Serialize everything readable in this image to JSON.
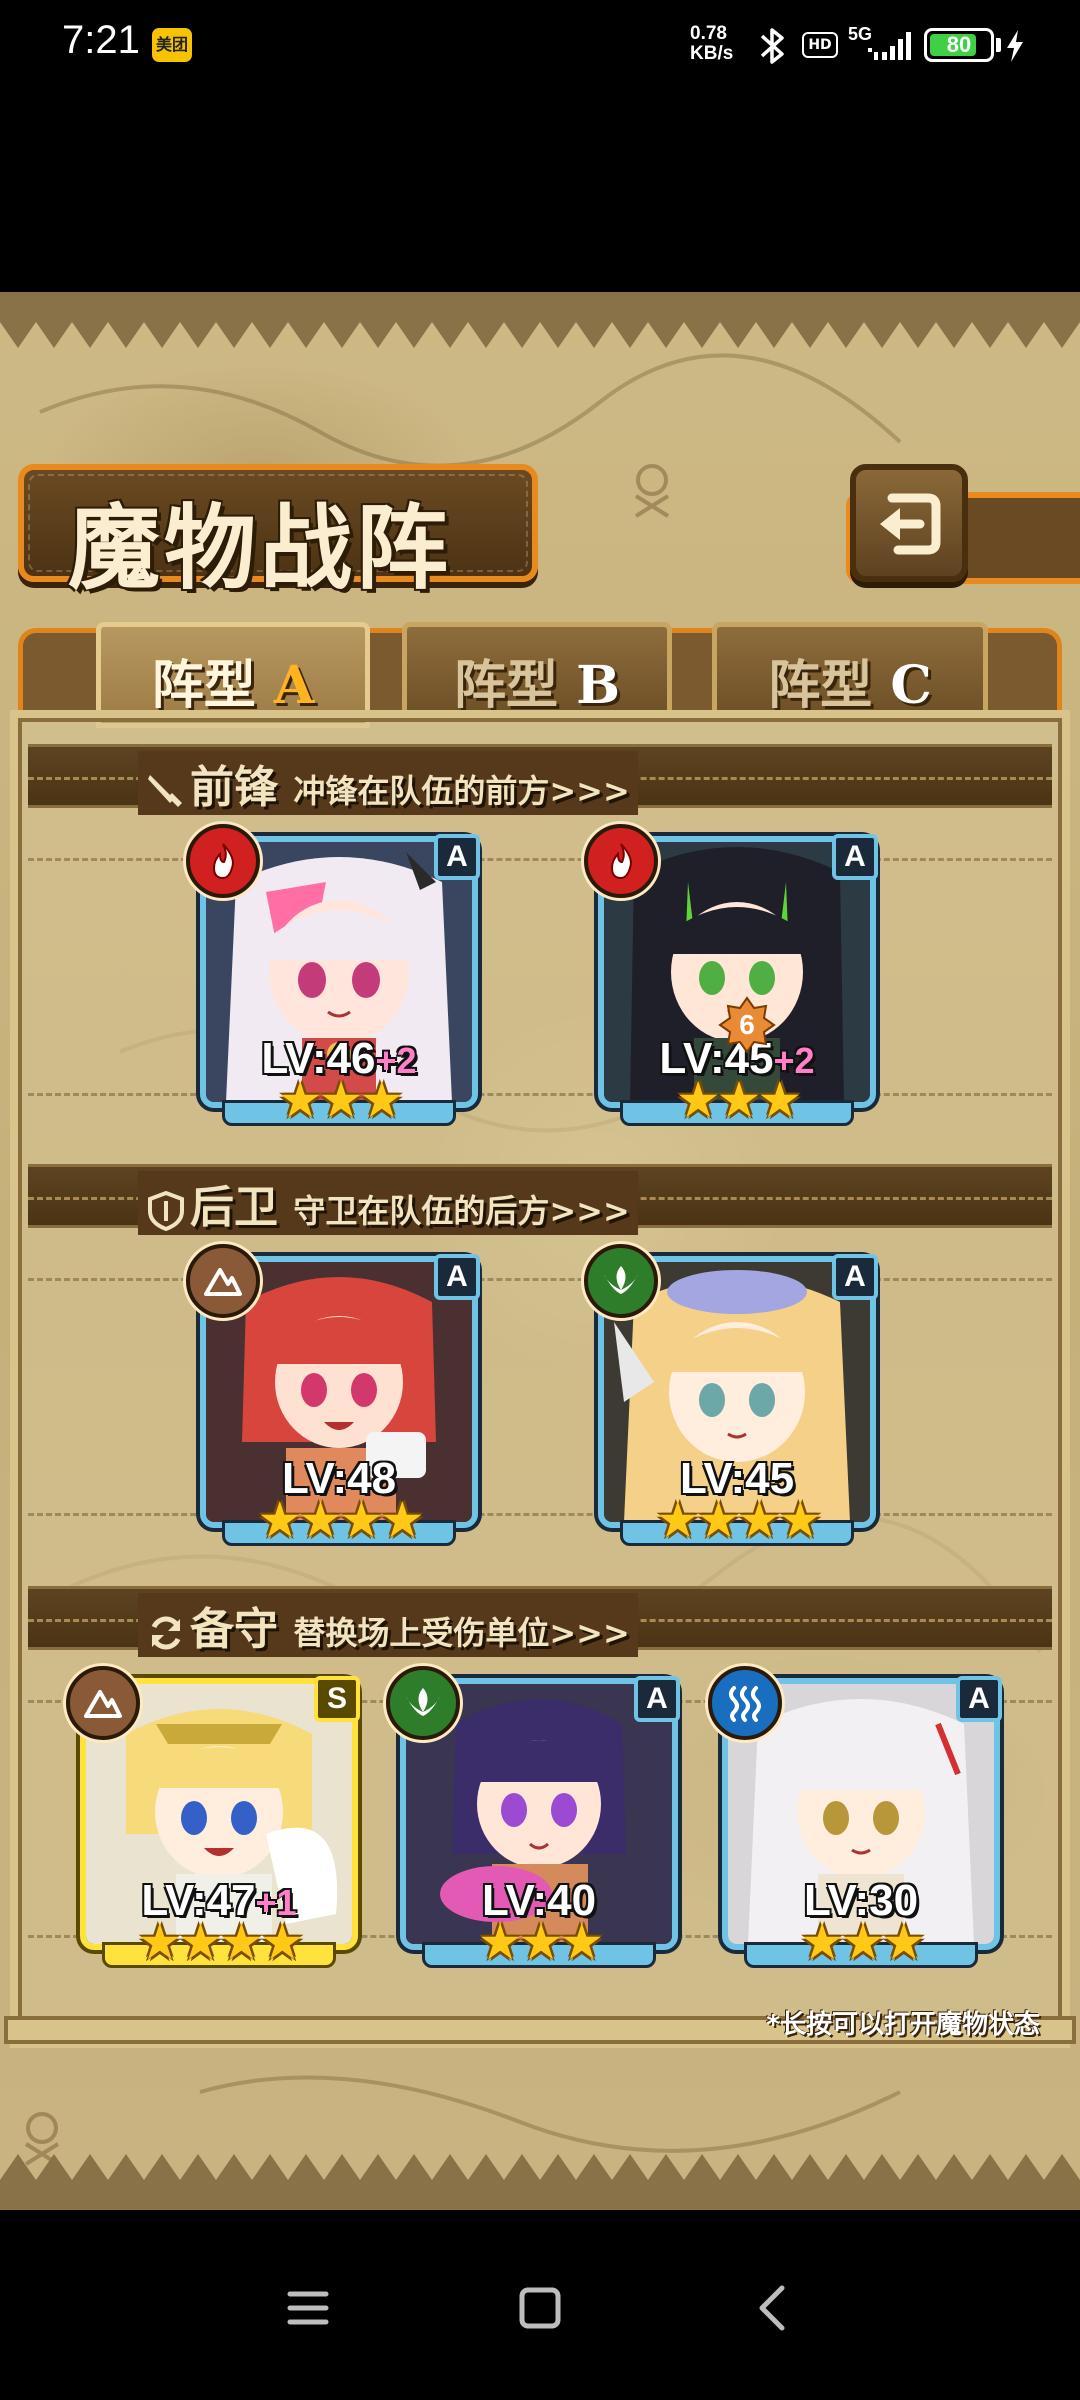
{
  "status_bar": {
    "time": "7:21",
    "app_badge": "美团",
    "net_speed_value": "0.78",
    "net_speed_unit": "KB/s",
    "hd_label": "HD",
    "signal_label": "5G",
    "battery_level": "80",
    "battery_fraction": 0.8,
    "icons": [
      "bluetooth-icon",
      "hd-icon",
      "signal-icon",
      "battery-icon",
      "charging-icon"
    ]
  },
  "header": {
    "title": "魔物战阵",
    "back_icon": "return-arrow-icon"
  },
  "tabs": [
    {
      "prefix": "阵型",
      "letter": "A",
      "active": true
    },
    {
      "prefix": "阵型",
      "letter": "B",
      "active": false
    },
    {
      "prefix": "阵型",
      "letter": "C",
      "active": false
    }
  ],
  "sections": {
    "front": {
      "title": "前锋",
      "desc": "冲锋在队伍的前方>>>",
      "icon": "sword-icon"
    },
    "rear": {
      "title": "后卫",
      "desc": "守卫在队伍的后方>>>",
      "icon": "shield-icon"
    },
    "reserve": {
      "title": "备守",
      "desc": "替换场上受伤单位>>>",
      "icon": "swap-icon"
    }
  },
  "cards": {
    "front_1": {
      "rank": "A",
      "element": "fire",
      "level": "LV:46",
      "plus": "+2",
      "stars": "★★★",
      "star_count": 3
    },
    "front_2": {
      "rank": "A",
      "element": "fire",
      "level": "LV:45",
      "plus": "+2",
      "stars": "★★★",
      "star_count": 3,
      "skill_badge": "6"
    },
    "rear_1": {
      "rank": "A",
      "element": "earth",
      "level": "LV:48",
      "plus": "",
      "stars": "★★★★",
      "star_count": 4
    },
    "rear_2": {
      "rank": "A",
      "element": "wood",
      "level": "LV:45",
      "plus": "",
      "stars": "★★★★",
      "star_count": 4
    },
    "reserve_1": {
      "rank": "S",
      "element": "earth",
      "level": "LV:47",
      "plus": "+1",
      "stars": "★★★★",
      "star_count": 4
    },
    "reserve_2": {
      "rank": "A",
      "element": "wood",
      "level": "LV:40",
      "plus": "",
      "stars": "★★★",
      "star_count": 3
    },
    "reserve_3": {
      "rank": "A",
      "element": "water",
      "level": "LV:30",
      "plus": "",
      "stars": "★★★",
      "star_count": 3
    }
  },
  "hint": "*长按可以打开魔物状态",
  "colors": {
    "frame_blue": "#6fc4e6",
    "frame_gold": "#ffe23c",
    "fire": "#d02020",
    "earth": "#8a5a38",
    "wood": "#2e7d2a",
    "water": "#1a6ec0",
    "accent_orange": "#e88a1e"
  },
  "nav_bar": {
    "icons": [
      "menu-icon",
      "home-icon",
      "back-icon"
    ]
  }
}
